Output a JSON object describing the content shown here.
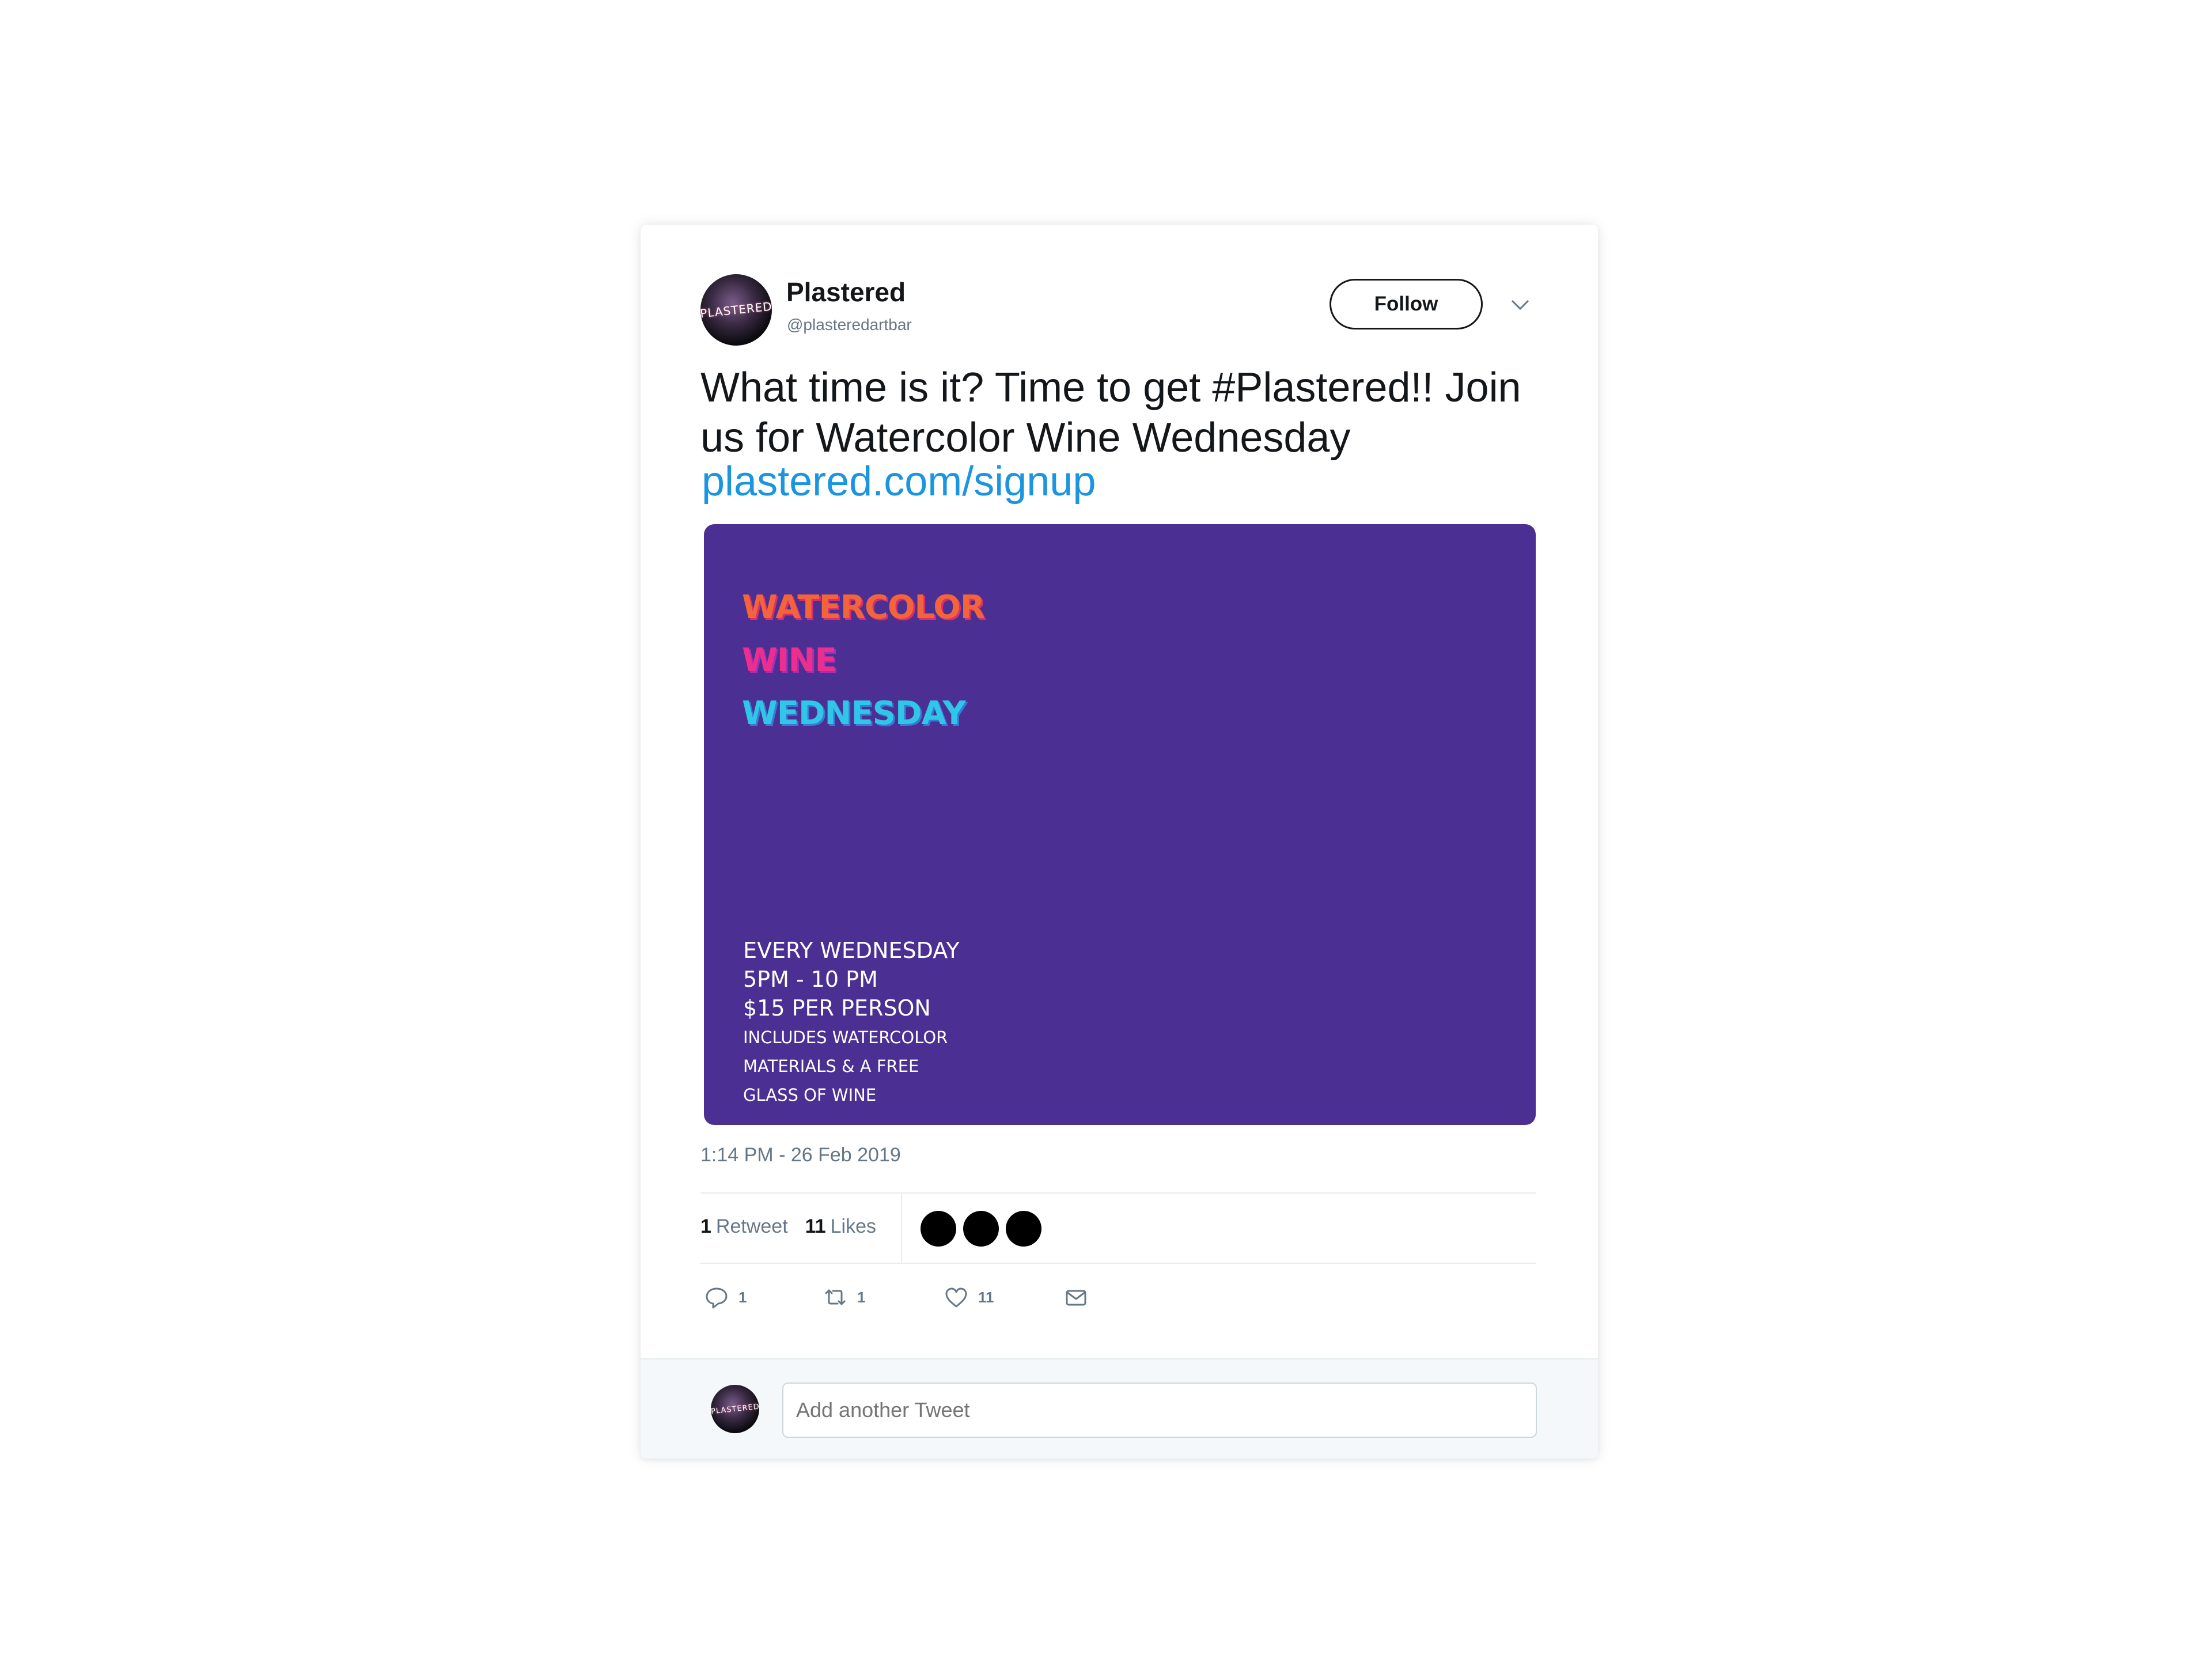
{
  "account": {
    "name": "Plastered",
    "handle": "@plasteredartbar",
    "avatar_label": "PLASTERED"
  },
  "header": {
    "follow_label": "Follow",
    "menu_icon": "chevron-down-icon"
  },
  "tweet": {
    "text": "What time is it? Time to get #Plastered!! Join us for Watercolor Wine Wednesday",
    "link": "plastered.com/signup",
    "timestamp": "1:14 PM - 26 Feb 2019"
  },
  "media": {
    "headline": [
      "WATERCOLOR",
      "WINE",
      "WEDNESDAY"
    ],
    "details": [
      "EVERY WEDNESDAY",
      "5PM - 10 PM",
      "$15 PER PERSON"
    ],
    "fine_print": [
      "INCLUDES WATERCOLOR",
      "MATERIALS & A FREE",
      "GLASS OF WINE"
    ],
    "background_color": "#4b2f93"
  },
  "stats": {
    "retweets_count": "1",
    "retweets_label": "Retweet",
    "likes_count": "11",
    "likes_label": "Likes"
  },
  "actions": {
    "reply_count": "1",
    "retweet_count": "1",
    "like_count": "11"
  },
  "reply": {
    "placeholder": "Add another Tweet"
  },
  "colors": {
    "link": "#1b95e0",
    "muted": "#657786",
    "text": "#14171a"
  }
}
